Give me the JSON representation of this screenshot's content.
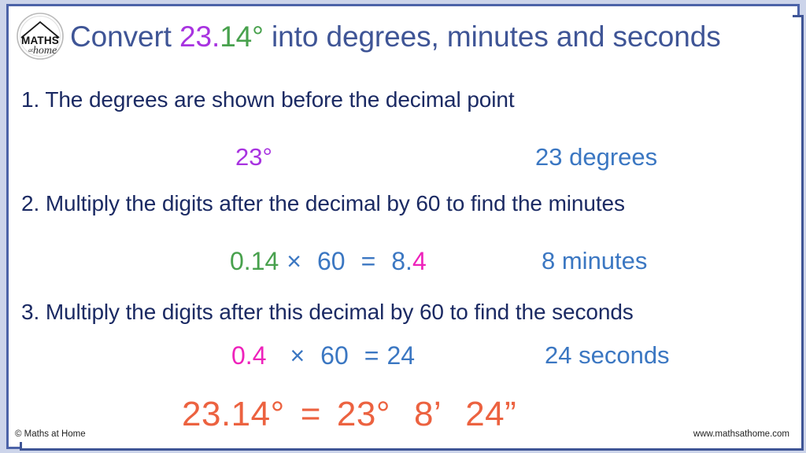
{
  "slide": {
    "logo": {
      "name": "maths-at-home-logo",
      "word_top": "MATHS",
      "word_small": "at",
      "word_script": "home"
    },
    "title": {
      "prefix": "Convert ",
      "value_int": "23",
      "value_dot": ".",
      "value_frac": "14",
      "value_degree": "°",
      "suffix": " into degrees, minutes and seconds"
    },
    "steps": [
      {
        "id": "step-1",
        "text": "1. The degrees are shown before the decimal point",
        "working": {
          "value": "23°"
        },
        "result": "23 degrees"
      },
      {
        "id": "step-2",
        "text": "2. Multiply the digits after the decimal by 60 to find the minutes",
        "working": {
          "operand_a": "0.14",
          "times": "×",
          "operand_b": "60",
          "equals": "=",
          "result_whole": "8.",
          "result_frac": "4"
        },
        "result": "8 minutes"
      },
      {
        "id": "step-3",
        "text": "3. Multiply the digits after this decimal by 60 to find the seconds",
        "working": {
          "operand_a": "0.4",
          "times": "×",
          "operand_b": "60",
          "equals": "=",
          "result_whole": "24"
        },
        "result": "24 seconds"
      }
    ],
    "answer": {
      "left": "23.14°",
      "equals": "=",
      "degrees": "23°",
      "minutes": "8’",
      "seconds": "24”"
    },
    "footer": {
      "copyright": "© Maths at Home",
      "website": "www.mathsathome.com"
    },
    "colors": {
      "title_blue": "#3f5596",
      "step_navy": "#1b2a63",
      "magenta": "#a833e0",
      "pink": "#ee22bb",
      "green": "#48a14d",
      "result_blue": "#3b77c2",
      "answer_orange": "#ec6240",
      "frame_blue": "#3f5596",
      "page_background": "#ccd4ea"
    }
  }
}
